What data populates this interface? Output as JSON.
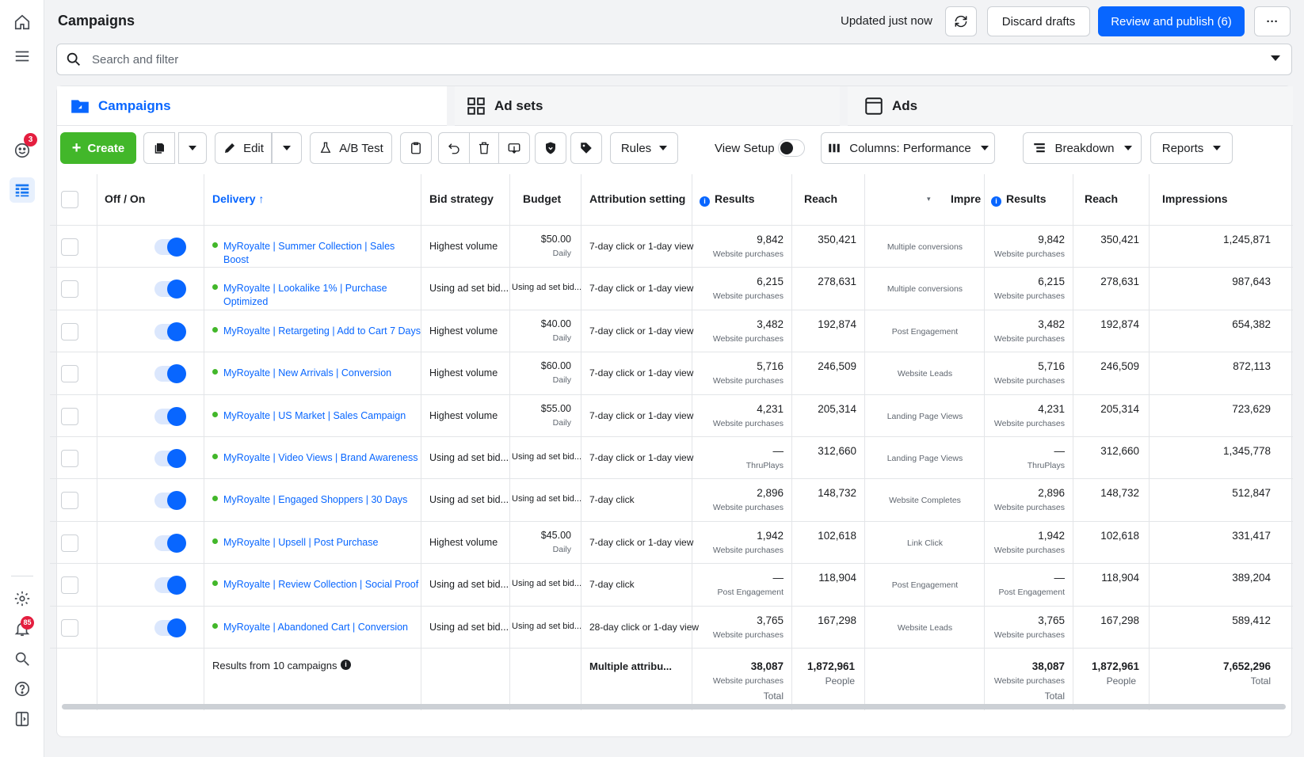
{
  "rail": {
    "notifications_badge": "3",
    "alerts_badge": "85"
  },
  "header": {
    "title": "Campaigns",
    "updated": "Updated just now",
    "discard": "Discard drafts",
    "publish": "Review and publish (6)",
    "more": "···"
  },
  "search": {
    "placeholder": "Search and filter"
  },
  "tabs": {
    "campaigns": "Campaigns",
    "adsets": "Ad sets",
    "ads": "Ads"
  },
  "toolbar": {
    "create": "Create",
    "edit": "Edit",
    "abtest": "A/B Test",
    "rules": "Rules",
    "view_setup": "View Setup",
    "columns": "Columns: Performance",
    "breakdown": "Breakdown",
    "reports": "Reports"
  },
  "columns": {
    "offon": "Off / On",
    "delivery": "Delivery",
    "bid": "Bid strategy",
    "budget": "Budget",
    "attribution": "Attribution setting",
    "results": "Results",
    "reach": "Reach",
    "impre_trunc": "Impre",
    "results2": "Results",
    "reach2": "Reach",
    "impressions": "Impressions"
  },
  "rows": [
    {
      "name": "MyRoyalte | Summer Collection | Sales Boost",
      "bid": "Highest volume",
      "budget": "$50.00",
      "budget_sub": "Daily",
      "attr": "7-day click or 1-day view",
      "results": "9,842",
      "results_sub": "Website purchases",
      "reach": "350,421",
      "conv": "Multiple conversions",
      "results2": "9,842",
      "results2_sub": "Website purchases",
      "reach2": "350,421",
      "impressions": "1,245,871"
    },
    {
      "name": "MyRoyalte | Lookalike 1% | Purchase Optimized",
      "bid": "Using ad set bid...",
      "budget": "Using ad set bid...",
      "budget_sub": "",
      "attr": "7-day click or 1-day view",
      "results": "6,215",
      "results_sub": "Website purchases",
      "reach": "278,631",
      "conv": "Multiple conversions",
      "results2": "6,215",
      "results2_sub": "Website purchases",
      "reach2": "278,631",
      "impressions": "987,643"
    },
    {
      "name": "MyRoyalte | Retargeting | Add to Cart 7 Days",
      "bid": "Highest volume",
      "budget": "$40.00",
      "budget_sub": "Daily",
      "attr": "7-day click or 1-day view",
      "results": "3,482",
      "results_sub": "Website purchases",
      "reach": "192,874",
      "conv": "Post Engagement",
      "results2": "3,482",
      "results2_sub": "Website purchases",
      "reach2": "192,874",
      "impressions": "654,382"
    },
    {
      "name": "MyRoyalte | New Arrivals | Conversion",
      "bid": "Highest volume",
      "budget": "$60.00",
      "budget_sub": "Daily",
      "attr": "7-day click or 1-day view",
      "results": "5,716",
      "results_sub": "Website purchases",
      "reach": "246,509",
      "conv": "Website Leads",
      "results2": "5,716",
      "results2_sub": "Website purchases",
      "reach2": "246,509",
      "impressions": "872,113"
    },
    {
      "name": "MyRoyalte | US Market | Sales Campaign",
      "bid": "Highest volume",
      "budget": "$55.00",
      "budget_sub": "Daily",
      "attr": "7-day click or 1-day view",
      "results": "4,231",
      "results_sub": "Website purchases",
      "reach": "205,314",
      "conv": "Landing Page Views",
      "results2": "4,231",
      "results2_sub": "Website purchases",
      "reach2": "205,314",
      "impressions": "723,629"
    },
    {
      "name": "MyRoyalte | Video Views | Brand Awareness",
      "bid": "Using ad set bid...",
      "budget": "Using ad set bid...",
      "budget_sub": "",
      "attr": "7-day click or 1-day view",
      "results": "—",
      "results_sub": "ThruPlays",
      "reach": "312,660",
      "conv": "Landing Page Views",
      "results2": "—",
      "results2_sub": "ThruPlays",
      "reach2": "312,660",
      "impressions": "1,345,778"
    },
    {
      "name": "MyRoyalte | Engaged Shoppers | 30 Days",
      "bid": "Using ad set bid...",
      "budget": "Using ad set bid...",
      "budget_sub": "",
      "attr": "7-day click",
      "results": "2,896",
      "results_sub": "Website purchases",
      "reach": "148,732",
      "conv": "Website Completes",
      "results2": "2,896",
      "results2_sub": "Website purchases",
      "reach2": "148,732",
      "impressions": "512,847"
    },
    {
      "name": "MyRoyalte | Upsell | Post Purchase",
      "bid": "Highest volume",
      "budget": "$45.00",
      "budget_sub": "Daily",
      "attr": "7-day click or 1-day view",
      "results": "1,942",
      "results_sub": "Website purchases",
      "reach": "102,618",
      "conv": "Link Click",
      "results2": "1,942",
      "results2_sub": "Website purchases",
      "reach2": "102,618",
      "impressions": "331,417"
    },
    {
      "name": "MyRoyalte | Review Collection | Social Proof",
      "bid": "Using ad set bid...",
      "budget": "Using ad set bid...",
      "budget_sub": "",
      "attr": "7-day click",
      "results": "—",
      "results_sub": "Post Engagement",
      "reach": "118,904",
      "conv": "Post Engagement",
      "results2": "—",
      "results2_sub": "Post Engagement",
      "reach2": "118,904",
      "impressions": "389,204"
    },
    {
      "name": "MyRoyalte | Abandoned Cart | Conversion",
      "bid": "Using ad set bid...",
      "budget": "Using ad set bid...",
      "budget_sub": "",
      "attr": "28-day click or 1-day view",
      "results": "3,765",
      "results_sub": "Website purchases",
      "reach": "167,298",
      "conv": "Website Leads",
      "results2": "3,765",
      "results2_sub": "Website purchases",
      "reach2": "167,298",
      "impressions": "589,412"
    }
  ],
  "footer": {
    "label": "Results from 10 campaigns",
    "attr": "Multiple attribu...",
    "results": "38,087",
    "results_sub": "Website purchases",
    "results_total": "Total",
    "reach": "1,872,961",
    "reach_sub": "People",
    "results2": "38,087",
    "results2_sub": "Website purchases",
    "results2_total": "Total",
    "reach2": "1,872,961",
    "reach2_sub": "People",
    "impressions": "7,652,296",
    "impressions_total": "Total"
  }
}
